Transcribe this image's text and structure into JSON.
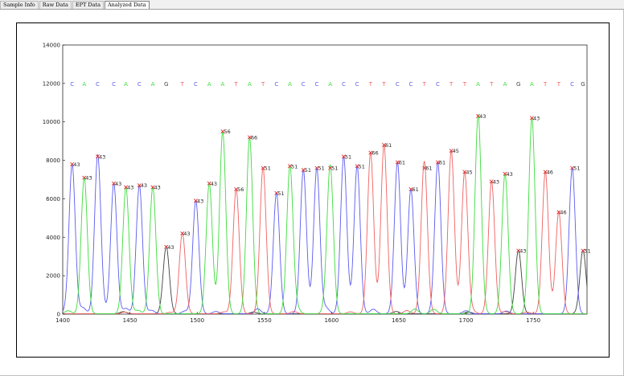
{
  "tabs": [
    {
      "label": "Sample Info"
    },
    {
      "label": "Raw Data"
    },
    {
      "label": "EPT Data"
    },
    {
      "label": "Analyzed Data",
      "active": true
    }
  ],
  "chart_data": {
    "type": "line",
    "xlim": [
      1400,
      1790
    ],
    "ylim": [
      0,
      14000
    ],
    "xticks": [
      1400,
      1450,
      1500,
      1550,
      1600,
      1650,
      1700,
      1750
    ],
    "yticks": [
      0,
      2000,
      4000,
      6000,
      8000,
      10000,
      12000,
      14000
    ],
    "grid": false,
    "base_colors": {
      "A": "#3cdc3c",
      "C": "#5b5bf0",
      "G": "#404040",
      "T": "#f06060"
    },
    "sequence_y": 12000,
    "peaks": [
      {
        "base": "C",
        "x": 1407,
        "h": 7800,
        "q": "43"
      },
      {
        "base": "A",
        "x": 1416,
        "h": 7100,
        "q": "43"
      },
      {
        "base": "C",
        "x": 1426,
        "h": 8200,
        "q": "43"
      },
      {
        "base": "C",
        "x": 1438,
        "h": 6800,
        "q": "43"
      },
      {
        "base": "A",
        "x": 1447,
        "h": 6600,
        "q": "43"
      },
      {
        "base": "C",
        "x": 1457,
        "h": 6700,
        "q": "43"
      },
      {
        "base": "A",
        "x": 1467,
        "h": 6600,
        "q": "43"
      },
      {
        "base": "G",
        "x": 1477,
        "h": 3500,
        "q": "43"
      },
      {
        "base": "T",
        "x": 1489,
        "h": 4200,
        "q": "43"
      },
      {
        "base": "C",
        "x": 1499,
        "h": 5900,
        "q": "43"
      },
      {
        "base": "A",
        "x": 1509,
        "h": 6800,
        "q": "43"
      },
      {
        "base": "A",
        "x": 1519,
        "h": 9500,
        "q": "56"
      },
      {
        "base": "T",
        "x": 1529,
        "h": 6500,
        "q": "56"
      },
      {
        "base": "A",
        "x": 1539,
        "h": 9200,
        "q": "66"
      },
      {
        "base": "T",
        "x": 1549,
        "h": 7600,
        "q": "51"
      },
      {
        "base": "C",
        "x": 1559,
        "h": 6300,
        "q": "51"
      },
      {
        "base": "A",
        "x": 1569,
        "h": 7700,
        "q": "51"
      },
      {
        "base": "C",
        "x": 1579,
        "h": 7500,
        "q": "51"
      },
      {
        "base": "C",
        "x": 1589,
        "h": 7600,
        "q": "51"
      },
      {
        "base": "A",
        "x": 1599,
        "h": 7600,
        "q": "51"
      },
      {
        "base": "C",
        "x": 1609,
        "h": 8200,
        "q": "51"
      },
      {
        "base": "C",
        "x": 1619,
        "h": 7700,
        "q": "51"
      },
      {
        "base": "T",
        "x": 1629,
        "h": 8400,
        "q": "66"
      },
      {
        "base": "T",
        "x": 1639,
        "h": 8800,
        "q": "61"
      },
      {
        "base": "C",
        "x": 1649,
        "h": 7900,
        "q": "61"
      },
      {
        "base": "C",
        "x": 1659,
        "h": 6500,
        "q": "61"
      },
      {
        "base": "T",
        "x": 1669,
        "h": 7600,
        "q": "61"
      },
      {
        "base": "C",
        "x": 1679,
        "h": 7900,
        "q": "61"
      },
      {
        "base": "T",
        "x": 1689,
        "h": 8500,
        "q": "45"
      },
      {
        "base": "T",
        "x": 1699,
        "h": 7400,
        "q": "45"
      },
      {
        "base": "A",
        "x": 1709,
        "h": 10300,
        "q": "43"
      },
      {
        "base": "T",
        "x": 1719,
        "h": 6900,
        "q": "43"
      },
      {
        "base": "A",
        "x": 1729,
        "h": 7300,
        "q": "43"
      },
      {
        "base": "G",
        "x": 1739,
        "h": 3300,
        "q": "43"
      },
      {
        "base": "A",
        "x": 1749,
        "h": 10200,
        "q": "43"
      },
      {
        "base": "T",
        "x": 1759,
        "h": 7400,
        "q": "46"
      },
      {
        "base": "T",
        "x": 1769,
        "h": 5300,
        "q": "46"
      },
      {
        "base": "C",
        "x": 1779,
        "h": 7600,
        "q": "51"
      },
      {
        "base": "G",
        "x": 1787,
        "h": 3300,
        "q": "51"
      }
    ]
  }
}
